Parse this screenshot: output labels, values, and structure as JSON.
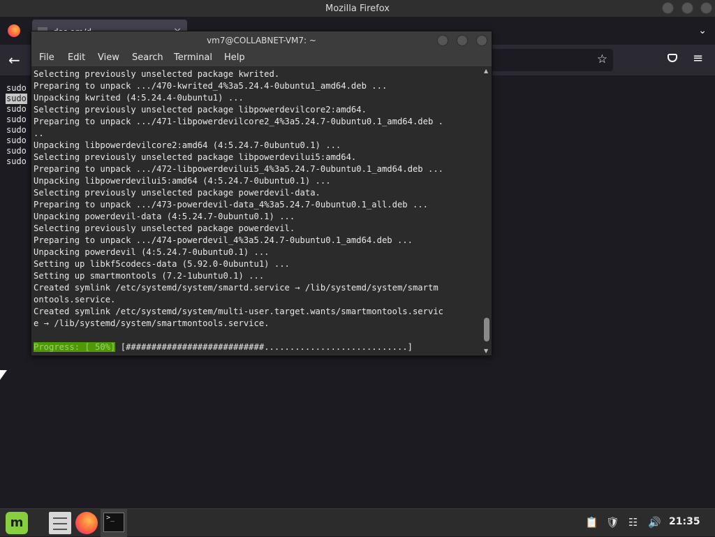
{
  "firefox": {
    "window_title": "Mozilla Firefox",
    "tab_title": "dsc.om/d...",
    "tab_close": "×",
    "tab_list_icon": "chevron-down-icon",
    "back_icon": "arrow-left-icon",
    "bookmark_icon": "star-icon",
    "pocket_icon": "pocket-icon",
    "menu_icon": "hamburger-icon",
    "background_lines": [
      "sudo",
      "sudo",
      "sudo",
      "sudo",
      "sudo",
      "sudo",
      "sudo",
      "sudo"
    ]
  },
  "terminal": {
    "title": "vm7@COLLABNET-VM7: ~",
    "menu": [
      "File",
      "Edit",
      "View",
      "Search",
      "Terminal",
      "Help"
    ],
    "lines": [
      "Selecting previously unselected package kwrited.",
      "Preparing to unpack .../470-kwrited_4%3a5.24.4-0ubuntu1_amd64.deb ...",
      "Unpacking kwrited (4:5.24.4-0ubuntu1) ...",
      "Selecting previously unselected package libpowerdevilcore2:amd64.",
      "Preparing to unpack .../471-libpowerdevilcore2_4%3a5.24.7-0ubuntu0.1_amd64.deb .",
      "..",
      "Unpacking libpowerdevilcore2:amd64 (4:5.24.7-0ubuntu0.1) ...",
      "Selecting previously unselected package libpowerdevilui5:amd64.",
      "Preparing to unpack .../472-libpowerdevilui5_4%3a5.24.7-0ubuntu0.1_amd64.deb ...",
      "Unpacking libpowerdevilui5:amd64 (4:5.24.7-0ubuntu0.1) ...",
      "Selecting previously unselected package powerdevil-data.",
      "Preparing to unpack .../473-powerdevil-data_4%3a5.24.7-0ubuntu0.1_all.deb ...",
      "Unpacking powerdevil-data (4:5.24.7-0ubuntu0.1) ...",
      "Selecting previously unselected package powerdevil.",
      "Preparing to unpack .../474-powerdevil_4%3a5.24.7-0ubuntu0.1_amd64.deb ...",
      "Unpacking powerdevil (4:5.24.7-0ubuntu0.1) ...",
      "Setting up libkf5codecs-data (5.92.0-0ubuntu1) ...",
      "Setting up smartmontools (7.2-1ubuntu0.1) ...",
      "Created symlink /etc/systemd/system/smartd.service → /lib/systemd/system/smartm",
      "ontools.service.",
      "Created symlink /etc/systemd/system/multi-user.target.wants/smartmontools.servic",
      "e → /lib/systemd/system/smartmontools.service."
    ],
    "progress_label": "Progress: [ 50%]",
    "progress_bar": "[###########################............................]",
    "progress_percent": 50
  },
  "taskbar": {
    "menu_label": "m",
    "terminal_glyph": ">_",
    "clock": "21:35",
    "tray_icons": [
      "clipboard-icon",
      "shield-icon",
      "network-icon",
      "volume-icon"
    ]
  }
}
